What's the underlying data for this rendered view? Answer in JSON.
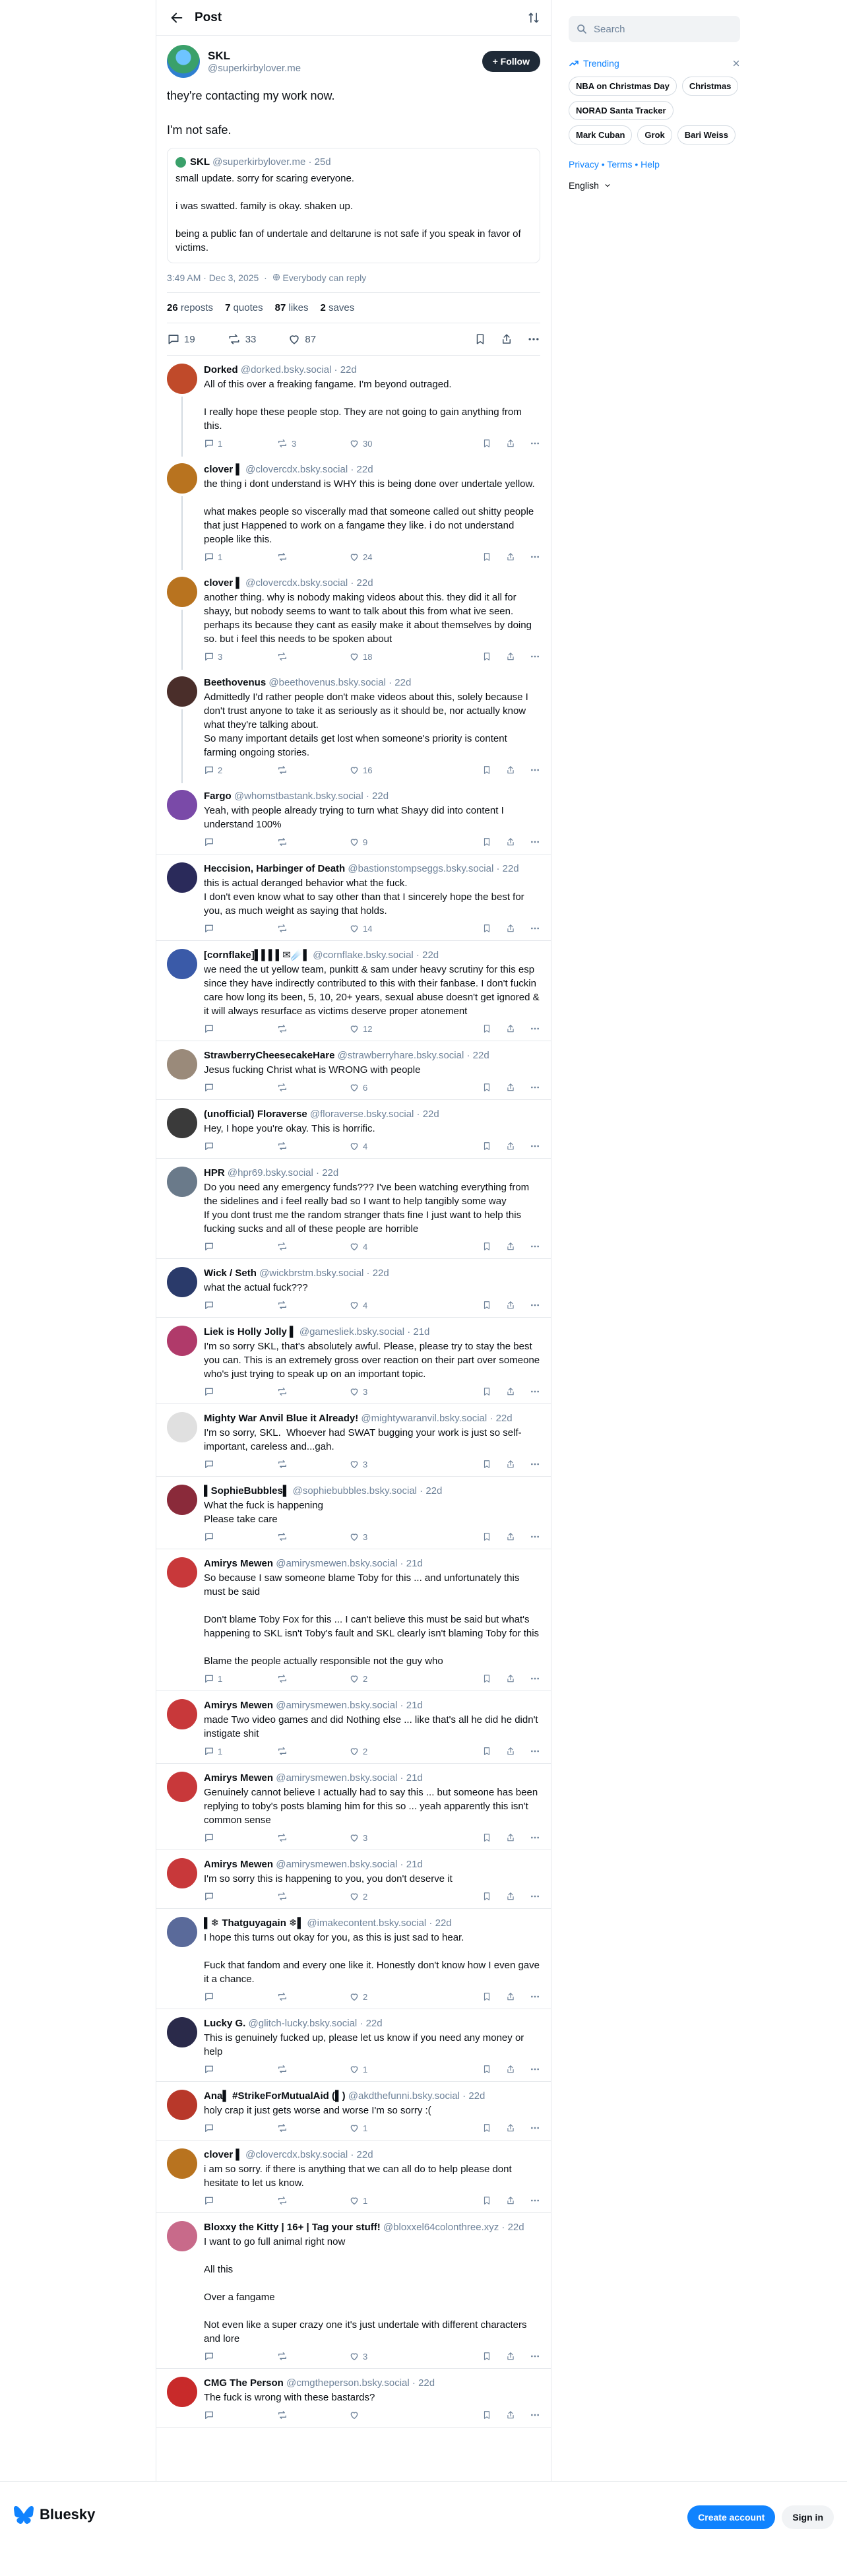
{
  "header": {
    "title": "Post"
  },
  "post": {
    "name": "SKL",
    "handle": "@superkirbylover.me",
    "follow_label": "Follow",
    "text": "they're contacting my work now.\n\nI'm not safe.",
    "quote": {
      "name": "SKL",
      "handle": "@superkirbylover.me",
      "age": "25d",
      "text": "small update. sorry for scaring everyone.\n\ni was swatted. family is okay. shaken up.\n\nbeing a public fan of undertale and deltarune is not safe if you speak in favor of victims."
    },
    "timestamp": "3:49 AM · Dec 3, 2025",
    "visibility": "Everybody can reply",
    "stats": {
      "reposts": "26",
      "reposts_label": "reposts",
      "quotes": "7",
      "quotes_label": "quotes",
      "likes": "87",
      "likes_label": "likes",
      "saves": "2",
      "saves_label": "saves"
    },
    "counts": {
      "replies": "19",
      "reposts": "33",
      "likes": "87"
    }
  },
  "replies": [
    {
      "name": "Dorked",
      "handle": "@dorked.bsky.social",
      "age": "22d",
      "text": "All of this over a freaking fangame. I'm beyond outraged.\n\nI really hope these people stop. They are not going to gain anything from this.",
      "replies": "1",
      "reposts": "3",
      "likes": "30",
      "color": "#c04a2a",
      "threaded": true,
      "has_line": true
    },
    {
      "name": "clover ▌",
      "handle": "@clovercdx.bsky.social",
      "age": "22d",
      "text": "the thing i dont understand is WHY this is being done over undertale yellow.\n\nwhat makes people so viscerally mad that someone called out shitty people that just Happened to work on a fangame they like. i do not understand people like this.",
      "replies": "1",
      "reposts": "",
      "likes": "24",
      "color": "#b8731f",
      "threaded": true,
      "has_line": true
    },
    {
      "name": "clover ▌",
      "handle": "@clovercdx.bsky.social",
      "age": "22d",
      "text": "another thing. why is nobody making videos about this. they did it all for shayy, but nobody seems to want to talk about this from what ive seen. perhaps its because they cant as easily make it about themselves by doing so. but i feel this needs to be spoken about",
      "replies": "3",
      "reposts": "",
      "likes": "18",
      "color": "#b8731f",
      "threaded": true,
      "has_line": true
    },
    {
      "name": "Beethovenus",
      "handle": "@beethovenus.bsky.social",
      "age": "22d",
      "text": "Admittedly I'd rather people don't make videos about this, solely because I don't trust anyone to take it as seriously as it should be, nor actually know what they're talking about.\nSo many important details get lost when someone's priority is content farming ongoing stories.",
      "replies": "2",
      "reposts": "",
      "likes": "16",
      "color": "#4a2e2a",
      "threaded": true,
      "has_line": true
    },
    {
      "name": "Fargo",
      "handle": "@whomstbastank.bsky.social",
      "age": "22d",
      "text": "Yeah, with people already trying to turn what Shayy did into content I understand 100%",
      "replies": "",
      "reposts": "",
      "likes": "9",
      "color": "#7a4aa8",
      "threaded": false,
      "has_line": false
    },
    {
      "name": "Heccision, Harbinger of Death",
      "handle": "@bastionstompseggs.bsky.social",
      "age": "22d",
      "text": "this is actual deranged behavior what the fuck.\nI don't even know what to say other than that I sincerely hope the best for you, as much weight as saying that holds.",
      "replies": "",
      "reposts": "",
      "likes": "14",
      "color": "#2a2a5a",
      "threaded": false,
      "has_line": false
    },
    {
      "name": "[cornflake]▌▌▌▌✉☄️▌",
      "handle": "@cornflake.bsky.social",
      "age": "22d",
      "text": "we need the ut yellow team, punkitt & sam under heavy scrutiny for this esp since they have indirectly contributed to this with their fanbase. I don't fuckin care how long its been, 5, 10, 20+ years, sexual abuse doesn't get ignored & it will always resurface as victims deserve proper atonement",
      "replies": "",
      "reposts": "",
      "likes": "12",
      "color": "#3a5aa8",
      "threaded": false,
      "has_line": false
    },
    {
      "name": "StrawberryCheesecakeHare",
      "handle": "@strawberryhare.bsky.social",
      "age": "22d",
      "text": "Jesus fucking Christ what is WRONG with people",
      "replies": "",
      "reposts": "",
      "likes": "6",
      "color": "#9a8a7a",
      "threaded": false,
      "has_line": false
    },
    {
      "name": "(unofficial) Floraverse",
      "handle": "@floraverse.bsky.social",
      "age": "22d",
      "text": "Hey, I hope you're okay. This is horrific.",
      "replies": "",
      "reposts": "",
      "likes": "4",
      "color": "#3a3a3a",
      "threaded": false,
      "has_line": false
    },
    {
      "name": "HPR",
      "handle": "@hpr69.bsky.social",
      "age": "22d",
      "text": "Do you need any emergency funds??? I've been watching everything from the sidelines and i feel really bad so I want to help tangibly some way\nIf you dont trust me the random stranger thats fine I just want to help this fucking sucks and all of these people are horrible",
      "replies": "",
      "reposts": "",
      "likes": "4",
      "color": "#6a7a8a",
      "threaded": false,
      "has_line": false
    },
    {
      "name": "Wick / Seth",
      "handle": "@wickbrstm.bsky.social",
      "age": "22d",
      "text": "what the actual fuck???",
      "replies": "",
      "reposts": "",
      "likes": "4",
      "color": "#2a3a6a",
      "threaded": false,
      "has_line": false
    },
    {
      "name": "Liek is Holly Jolly ▌",
      "handle": "@gamesliek.bsky.social",
      "age": "21d",
      "text": "I'm so sorry SKL, that's absolutely awful. Please, please try to stay the best you can. This is an extremely gross over reaction on their part over someone who's just trying to speak up on an important topic.",
      "replies": "",
      "reposts": "",
      "likes": "3",
      "color": "#b03a6a",
      "threaded": false,
      "has_line": false
    },
    {
      "name": "Mighty War Anvil Blue it Already!",
      "handle": "@mightywaranvil.bsky.social",
      "age": "22d",
      "text": "I'm so sorry, SKL.  Whoever had SWAT bugging your work is just so self-important, careless and...gah.",
      "replies": "",
      "reposts": "",
      "likes": "3",
      "color": "#e0e0e0",
      "threaded": false,
      "has_line": false
    },
    {
      "name": "▌SophieBubbles▌",
      "handle": "@sophiebubbles.bsky.social",
      "age": "22d",
      "text": "What the fuck is happening\nPlease take care",
      "replies": "",
      "reposts": "",
      "likes": "3",
      "color": "#8a2a3a",
      "threaded": false,
      "has_line": false
    },
    {
      "name": "Amirys Mewen",
      "handle": "@amirysmewen.bsky.social",
      "age": "21d",
      "text": "So because I saw someone blame Toby for this ... and unfortunately this must be said\n\nDon't blame Toby Fox for this ... I can't believe this must be said but what's happening to SKL isn't Toby's fault and SKL clearly isn't blaming Toby for this\n\nBlame the people actually responsible not the guy who",
      "replies": "1",
      "reposts": "",
      "likes": "2",
      "color": "#c8383a",
      "threaded": false,
      "has_line": false
    },
    {
      "name": "Amirys Mewen",
      "handle": "@amirysmewen.bsky.social",
      "age": "21d",
      "text": "made Two video games and did Nothing else ... like that's all he did he didn't instigate shit",
      "replies": "1",
      "reposts": "",
      "likes": "2",
      "color": "#c8383a",
      "threaded": false,
      "has_line": false
    },
    {
      "name": "Amirys Mewen",
      "handle": "@amirysmewen.bsky.social",
      "age": "21d",
      "text": "Genuinely cannot believe I actually had to say this ... but someone has been replying to toby's posts blaming him for this so ... yeah apparently this isn't common sense",
      "replies": "",
      "reposts": "",
      "likes": "3",
      "color": "#c8383a",
      "threaded": false,
      "has_line": false
    },
    {
      "name": "Amirys Mewen",
      "handle": "@amirysmewen.bsky.social",
      "age": "21d",
      "text": "I'm so sorry this is happening to you, you don't deserve it",
      "replies": "",
      "reposts": "",
      "likes": "2",
      "color": "#c8383a",
      "threaded": false,
      "has_line": false
    },
    {
      "name": "▌❄ Thatguyagain ❄▌",
      "handle": "@imakecontent.bsky.social",
      "age": "22d",
      "text": "I hope this turns out okay for you, as this is just sad to hear.\n\nFuck that fandom and every one like it. Honestly don't know how I even gave it a chance.",
      "replies": "",
      "reposts": "",
      "likes": "2",
      "color": "#5a6a9a",
      "threaded": false,
      "has_line": false
    },
    {
      "name": "Lucky G.",
      "handle": "@glitch-lucky.bsky.social",
      "age": "22d",
      "text": "This is genuinely fucked up, please let us know if you need any money or help",
      "replies": "",
      "reposts": "",
      "likes": "1",
      "color": "#2a2a4a",
      "threaded": false,
      "has_line": false
    },
    {
      "name": "Ana▌ #StrikeForMutualAid (▌)",
      "handle": "@akdthefunni.bsky.social",
      "age": "22d",
      "text": "holy crap it just gets worse and worse I'm so sorry :(",
      "replies": "",
      "reposts": "",
      "likes": "1",
      "color": "#b8382a",
      "threaded": false,
      "has_line": false
    },
    {
      "name": "clover ▌",
      "handle": "@clovercdx.bsky.social",
      "age": "22d",
      "text": "i am so sorry. if there is anything that we can all do to help please dont hesitate to let us know.",
      "replies": "",
      "reposts": "",
      "likes": "1",
      "color": "#b8731f",
      "threaded": false,
      "has_line": false
    },
    {
      "name": "Bloxxy the Kitty | 16+ | Tag your stuff!",
      "handle": "@bloxxel64colonthree.xyz",
      "age": "22d",
      "text": "I want to go full animal right now\n\nAll this\n\nOver a fangame\n\nNot even like a super crazy one it's just undertale with different characters and lore",
      "replies": "",
      "reposts": "",
      "likes": "3",
      "color": "#c86a8a",
      "threaded": false,
      "has_line": false
    },
    {
      "name": "CMG The Person",
      "handle": "@cmgtheperson.bsky.social",
      "age": "22d",
      "text": "The fuck is wrong with these bastards?",
      "replies": "",
      "reposts": "",
      "likes": "",
      "color": "#c82a2a",
      "threaded": false,
      "has_line": false
    }
  ],
  "sidebar": {
    "search_placeholder": "Search",
    "trending_label": "Trending",
    "trending": [
      "NBA on Christmas Day",
      "Christmas",
      "NORAD Santa Tracker",
      "Mark Cuban",
      "Grok",
      "Bari Weiss"
    ],
    "links": {
      "privacy": "Privacy",
      "terms": "Terms",
      "help": "Help",
      "sep": " • "
    },
    "language": "English"
  },
  "footer": {
    "brand": "Bluesky",
    "create_account": "Create account",
    "sign_in": "Sign in"
  },
  "colors": {
    "accent": "#1083fe",
    "border": "#e5e8ec",
    "muted": "#6f839a"
  }
}
